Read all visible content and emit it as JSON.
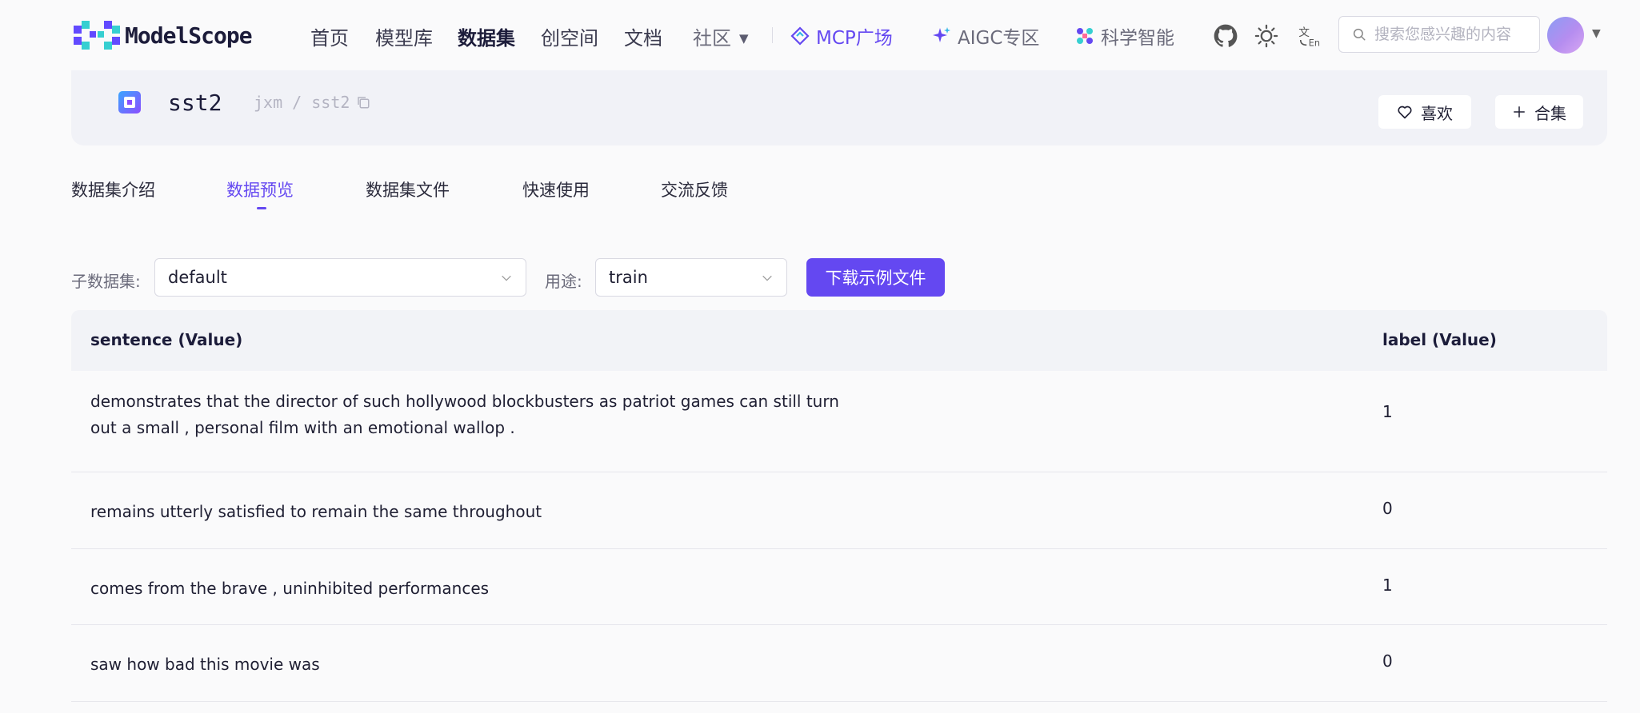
{
  "brand": {
    "name": "ModelScope"
  },
  "nav": {
    "items": [
      {
        "label": "首页",
        "active": false
      },
      {
        "label": "模型库",
        "active": false
      },
      {
        "label": "数据集",
        "active": true
      },
      {
        "label": "创空间",
        "active": false
      },
      {
        "label": "文档",
        "active": false
      },
      {
        "label": "社区",
        "active": false,
        "has_dropdown": true
      }
    ],
    "special": [
      {
        "label": "MCP广场",
        "icon": "mcp-icon",
        "color": "#6448f1"
      },
      {
        "label": "AIGC专区",
        "icon": "sparkle-icon",
        "color": "#6b6b7b"
      },
      {
        "label": "科学智能",
        "icon": "science-icon",
        "color": "#6b6b7b"
      }
    ],
    "icons": [
      "github-icon",
      "sun-icon",
      "language-icon"
    ],
    "search_placeholder": "搜索您感兴趣的内容"
  },
  "dataset": {
    "name": "sst2",
    "path": "jxm / sst2",
    "like_label": "喜欢",
    "collection_label": "合集"
  },
  "tabs": [
    {
      "label": "数据集介绍",
      "active": false
    },
    {
      "label": "数据预览",
      "active": true
    },
    {
      "label": "数据集文件",
      "active": false
    },
    {
      "label": "快速使用",
      "active": false
    },
    {
      "label": "交流反馈",
      "active": false
    }
  ],
  "filters": {
    "subset_label": "子数据集:",
    "subset_value": "default",
    "split_label": "用途:",
    "split_value": "train",
    "download_label": "下载示例文件"
  },
  "table": {
    "columns": [
      "sentence (Value)",
      "label (Value)"
    ],
    "rows": [
      {
        "sentence": "demonstrates that the director of such hollywood blockbusters as patriot games can still turn out a small , personal film with an emotional wallop .",
        "label": "1"
      },
      {
        "sentence": "remains utterly satisfied to remain the same throughout",
        "label": "0"
      },
      {
        "sentence": "comes from the brave , uninhibited performances",
        "label": "1"
      },
      {
        "sentence": "saw how bad this movie was",
        "label": "0"
      }
    ]
  },
  "colors": {
    "accent": "#6448f1",
    "header_bg": "#f1f2f7",
    "page_bg": "#fafafb"
  }
}
